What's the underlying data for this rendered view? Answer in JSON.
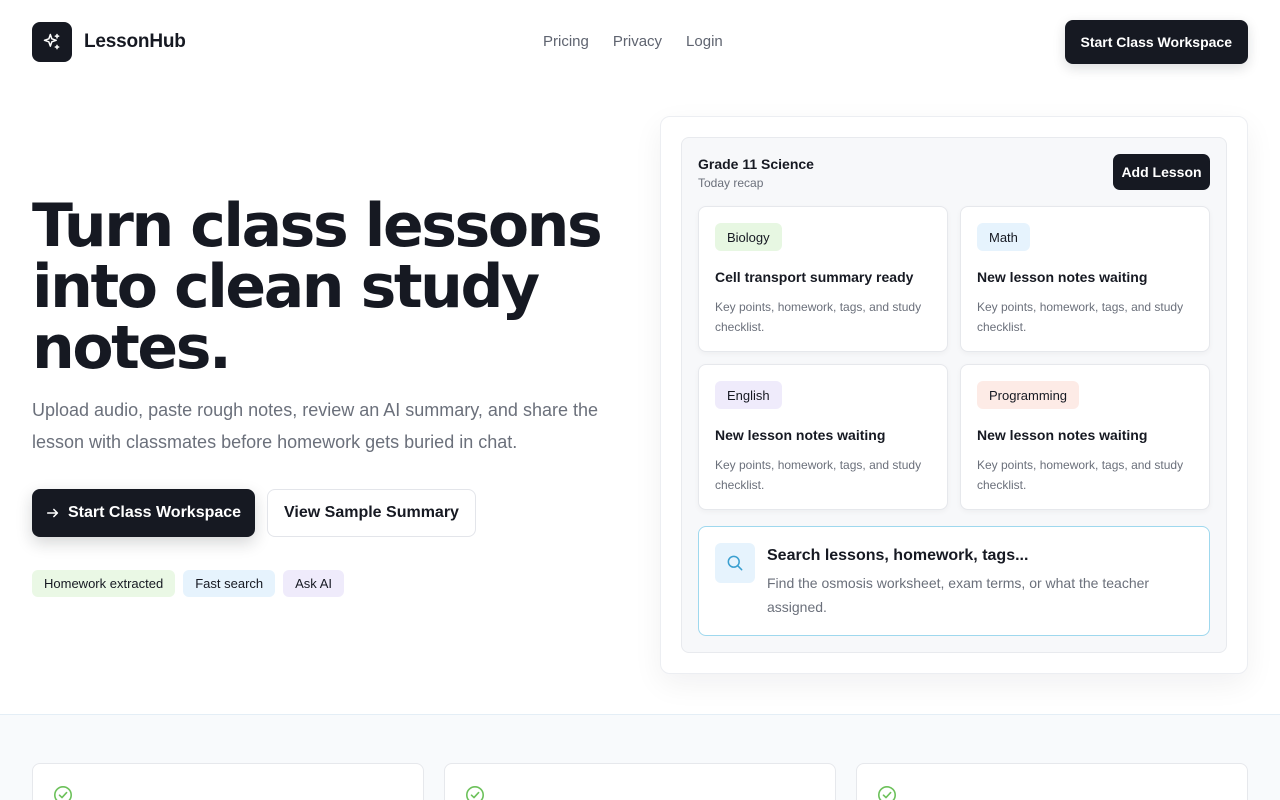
{
  "header": {
    "brand": "LessonHub",
    "nav": [
      "Pricing",
      "Privacy",
      "Login"
    ],
    "cta": "Start Class Workspace"
  },
  "hero": {
    "title": "Turn class lessons into clean study notes.",
    "subtitle": "Upload audio, paste rough notes, review an AI summary, and share the lesson with classmates before homework gets buried in chat.",
    "primary_button": "Start Class Workspace",
    "secondary_button": "View Sample Summary",
    "chips": [
      "Homework extracted",
      "Fast search",
      "Ask AI"
    ]
  },
  "panel": {
    "title": "Grade 11 Science",
    "subtitle": "Today recap",
    "add_button": "Add Lesson",
    "cards": [
      {
        "tag": "Biology",
        "title": "Cell transport summary ready",
        "desc": "Key points, homework, tags, and study checklist."
      },
      {
        "tag": "Math",
        "title": "New lesson notes waiting",
        "desc": "Key points, homework, tags, and study checklist."
      },
      {
        "tag": "English",
        "title": "New lesson notes waiting",
        "desc": "Key points, homework, tags, and study checklist."
      },
      {
        "tag": "Programming",
        "title": "New lesson notes waiting",
        "desc": "Key points, homework, tags, and study checklist."
      }
    ],
    "search": {
      "title": "Search lessons, homework, tags...",
      "desc": "Find the osmosis worksheet, exam terms, or what the teacher assigned."
    }
  },
  "colors": {
    "primary": "#161922",
    "muted_text": "#6b707b",
    "green_tint": "#e7f7e2",
    "blue_tint": "#e6f3fd",
    "purple_tint": "#efebfb",
    "red_tint": "#fdebe6",
    "check_green": "#6cc15a"
  },
  "icons": {
    "logo": "sparkle-icon",
    "primary_button": "arrow-right-icon",
    "search": "search-icon",
    "feature": "check-circle-icon"
  }
}
